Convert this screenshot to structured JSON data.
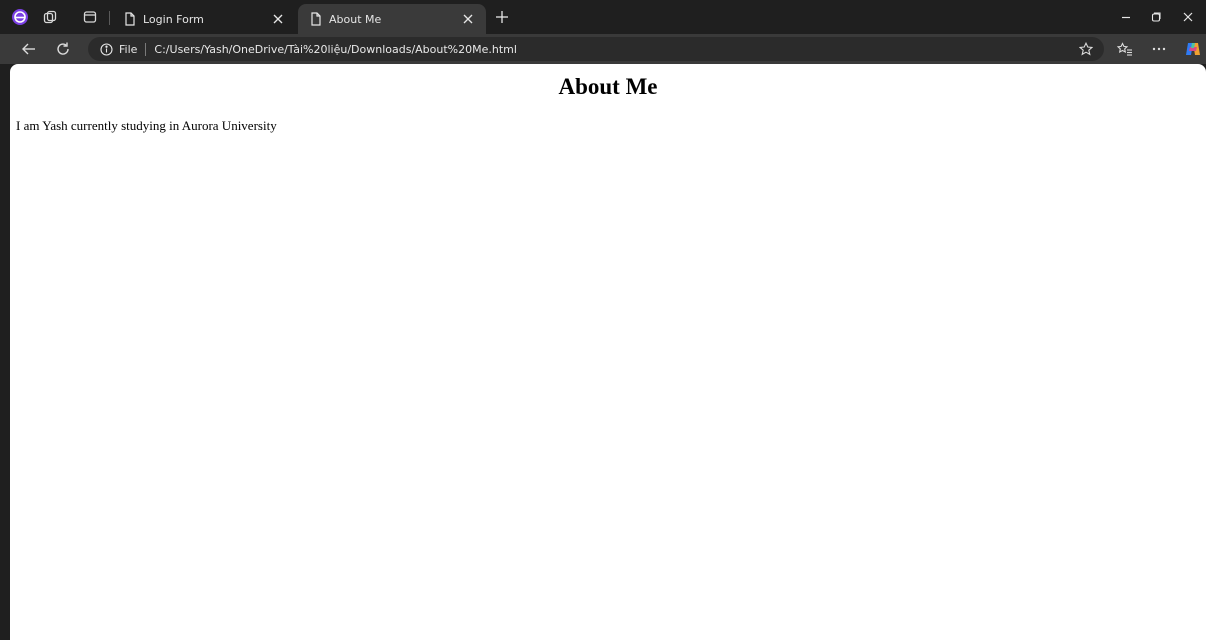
{
  "tabs": [
    {
      "title": "Login Form",
      "active": false
    },
    {
      "title": "About Me",
      "active": true
    }
  ],
  "address": {
    "file_label": "File",
    "url": "C:/Users/Yash/OneDrive/Tài%20liệu/Downloads/About%20Me.html"
  },
  "page": {
    "heading": "About Me",
    "paragraph": "I am Yash currently studying in Aurora University"
  },
  "colors": {
    "chrome_dark": "#1f1f1f",
    "toolbar": "#3a3a3a",
    "address_bg": "#2b2b2b",
    "content_bg": "#ffffff"
  },
  "icons": [
    "edge-profile-icon",
    "workspaces-icon",
    "tab-actions-icon",
    "page-icon",
    "close-icon",
    "new-tab-icon",
    "minimize-icon",
    "restore-icon",
    "back-icon",
    "refresh-icon",
    "info-icon",
    "favorite-star-icon",
    "favorites-icon",
    "more-icon",
    "copilot-icon"
  ]
}
